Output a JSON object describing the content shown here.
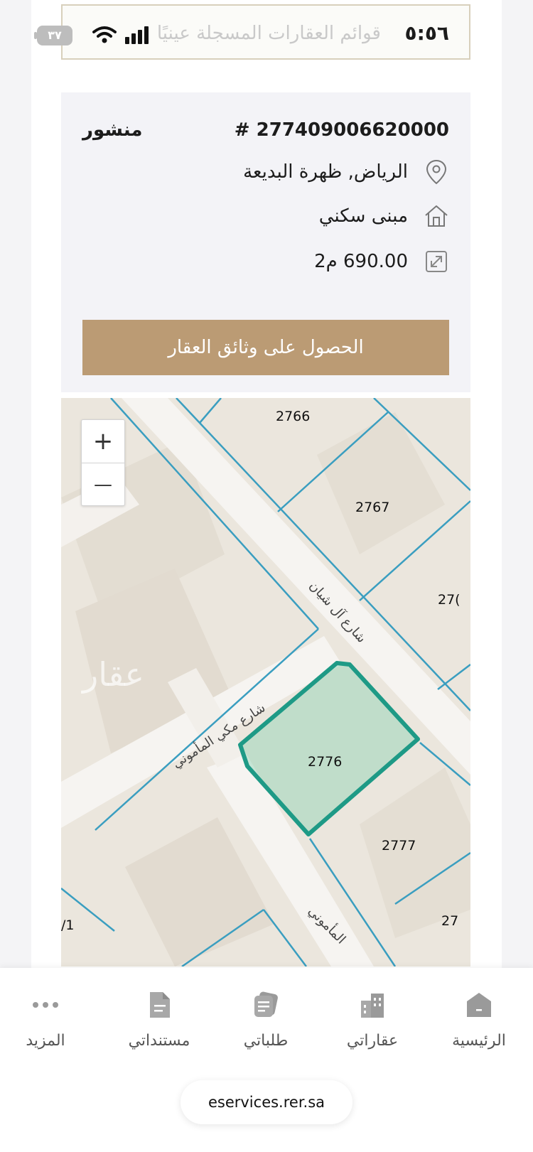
{
  "status_bar": {
    "time": "٥:٥٦",
    "title": "قوائم العقارات المسجلة عينيًا",
    "battery": "٣٧"
  },
  "property": {
    "id": "# 277409006620000",
    "status": "منشور",
    "location": "الرياض, ظهرة البديعة",
    "type": "مبنى سكني",
    "area": "690.00 م2",
    "docs_button": "الحصول على وثائق العقار"
  },
  "map": {
    "zoom_in": "+",
    "zoom_out": "—",
    "parcels": [
      {
        "label": "2766"
      },
      {
        "label": "2767"
      },
      {
        "label": "27("
      },
      {
        "label": "2776"
      },
      {
        "label": "2777"
      },
      {
        "label": "27"
      },
      {
        "label": "/1"
      }
    ],
    "streets": {
      "street_1": "شارع آل شيان",
      "street_2": "شارع مكي المأموني",
      "street_3": "المأموني"
    },
    "highlight_color": "#1e9a86",
    "line_color": "#3a9ec0",
    "watermark": "عقار"
  },
  "bottom_nav": {
    "items": [
      {
        "label": "الرئيسية",
        "icon": "home-icon"
      },
      {
        "label": "عقاراتي",
        "icon": "buildings-icon"
      },
      {
        "label": "طلباتي",
        "icon": "requests-icon"
      },
      {
        "label": "مستنداتي",
        "icon": "document-icon"
      },
      {
        "label": "المزيد",
        "icon": "more-icon"
      }
    ]
  },
  "browser": {
    "url": "eservices.rer.sa"
  }
}
